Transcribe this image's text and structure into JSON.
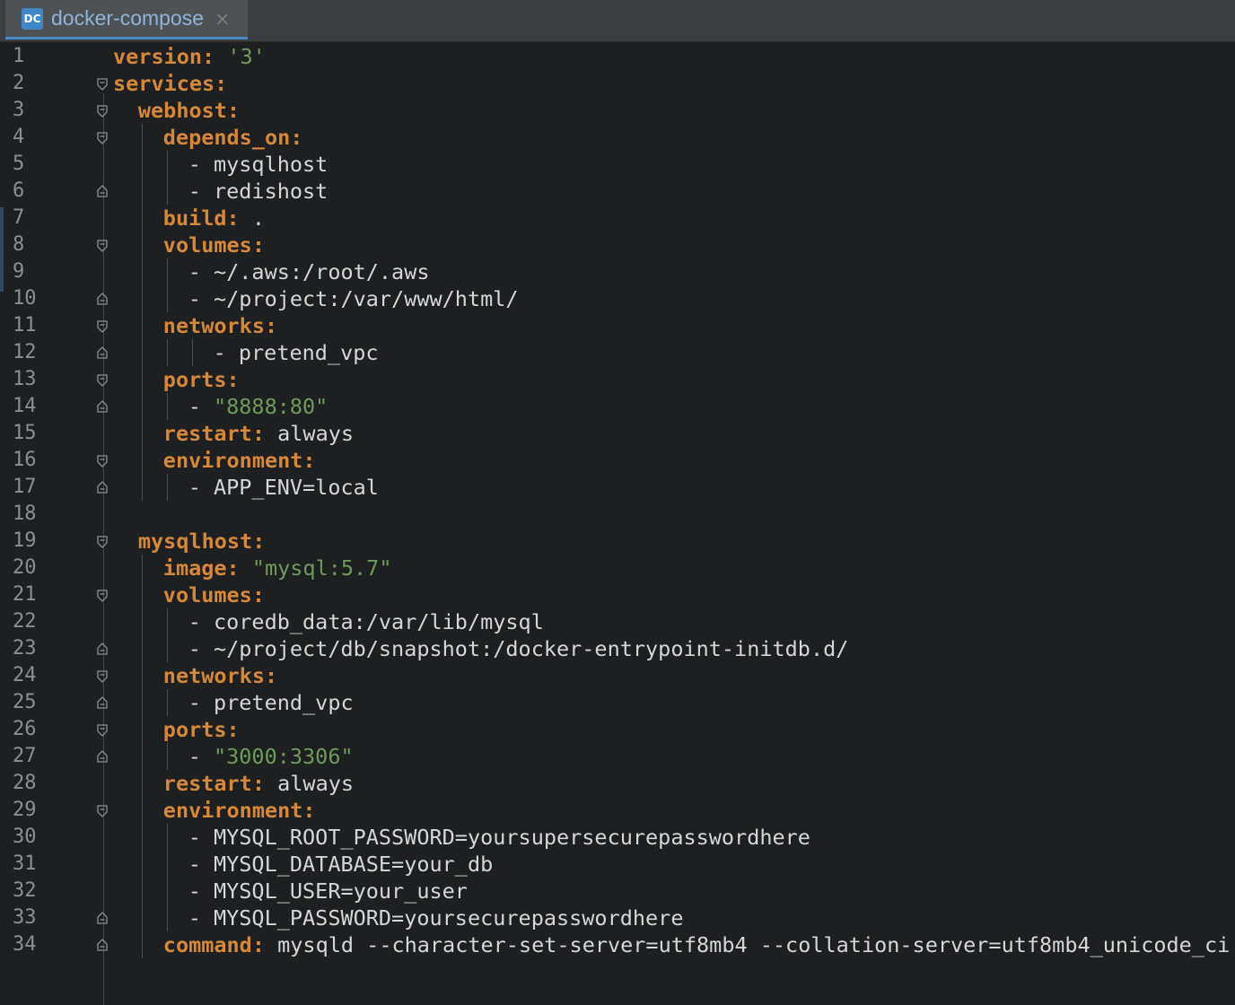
{
  "tab": {
    "icon_text": "DC",
    "title": "docker-compose",
    "close_glyph": "×"
  },
  "icons": {
    "file_icon": "docker-compose-file-icon",
    "close": "close-icon",
    "fold_open": "fold-open-icon",
    "fold_close": "fold-close-icon"
  },
  "colors": {
    "background": "#1e1f20",
    "key": "#d5873a",
    "string": "#6f9a5c",
    "text": "#d4d6d8",
    "line_number": "#8b8f93",
    "tab_accent": "#4a88c7"
  },
  "lines": [
    {
      "n": "1",
      "indent": 0,
      "fold": "",
      "parts": [
        {
          "t": "k",
          "text": "version:"
        },
        {
          "t": "v",
          "text": " "
        },
        {
          "t": "s",
          "text": "'3'"
        }
      ]
    },
    {
      "n": "2",
      "indent": 0,
      "fold": "open",
      "parts": [
        {
          "t": "k",
          "text": "services:"
        }
      ]
    },
    {
      "n": "3",
      "indent": 1,
      "fold": "open",
      "parts": [
        {
          "t": "k",
          "text": "webhost:"
        }
      ]
    },
    {
      "n": "4",
      "indent": 2,
      "fold": "open",
      "parts": [
        {
          "t": "k",
          "text": "depends_on:"
        }
      ]
    },
    {
      "n": "5",
      "indent": 3,
      "fold": "",
      "parts": [
        {
          "t": "v",
          "text": "- mysqlhost"
        }
      ]
    },
    {
      "n": "6",
      "indent": 3,
      "fold": "close",
      "parts": [
        {
          "t": "v",
          "text": "- redishost"
        }
      ]
    },
    {
      "n": "7",
      "indent": 2,
      "fold": "",
      "parts": [
        {
          "t": "k",
          "text": "build:"
        },
        {
          "t": "v",
          "text": " ."
        }
      ]
    },
    {
      "n": "8",
      "indent": 2,
      "fold": "open",
      "parts": [
        {
          "t": "k",
          "text": "volumes:"
        }
      ]
    },
    {
      "n": "9",
      "indent": 3,
      "fold": "",
      "parts": [
        {
          "t": "v",
          "text": "- ~/.aws:/root/.aws"
        }
      ]
    },
    {
      "n": "10",
      "indent": 3,
      "fold": "close",
      "parts": [
        {
          "t": "v",
          "text": "- ~/project:/var/www/html/"
        }
      ]
    },
    {
      "n": "11",
      "indent": 2,
      "fold": "open",
      "parts": [
        {
          "t": "k",
          "text": "networks:"
        }
      ]
    },
    {
      "n": "12",
      "indent": 4,
      "fold": "close",
      "parts": [
        {
          "t": "v",
          "text": "- pretend_vpc"
        }
      ]
    },
    {
      "n": "13",
      "indent": 2,
      "fold": "open",
      "parts": [
        {
          "t": "k",
          "text": "ports:"
        }
      ]
    },
    {
      "n": "14",
      "indent": 3,
      "fold": "close",
      "parts": [
        {
          "t": "v",
          "text": "- "
        },
        {
          "t": "s",
          "text": "\"8888:80\""
        }
      ]
    },
    {
      "n": "15",
      "indent": 2,
      "fold": "",
      "parts": [
        {
          "t": "k",
          "text": "restart:"
        },
        {
          "t": "v",
          "text": " always"
        }
      ]
    },
    {
      "n": "16",
      "indent": 2,
      "fold": "open",
      "parts": [
        {
          "t": "k",
          "text": "environment:"
        }
      ]
    },
    {
      "n": "17",
      "indent": 3,
      "fold": "close",
      "parts": [
        {
          "t": "v",
          "text": "- APP_ENV=local"
        }
      ]
    },
    {
      "n": "18",
      "indent": 0,
      "fold": "",
      "parts": []
    },
    {
      "n": "19",
      "indent": 1,
      "fold": "open",
      "parts": [
        {
          "t": "k",
          "text": "mysqlhost:"
        }
      ]
    },
    {
      "n": "20",
      "indent": 2,
      "fold": "",
      "parts": [
        {
          "t": "k",
          "text": "image:"
        },
        {
          "t": "v",
          "text": " "
        },
        {
          "t": "s",
          "text": "\"mysql:5.7\""
        }
      ]
    },
    {
      "n": "21",
      "indent": 2,
      "fold": "open",
      "parts": [
        {
          "t": "k",
          "text": "volumes:"
        }
      ]
    },
    {
      "n": "22",
      "indent": 3,
      "fold": "",
      "parts": [
        {
          "t": "v",
          "text": "- coredb_data:/var/lib/mysql"
        }
      ]
    },
    {
      "n": "23",
      "indent": 3,
      "fold": "close",
      "parts": [
        {
          "t": "v",
          "text": "- ~/project/db/snapshot:/docker-entrypoint-initdb.d/"
        }
      ]
    },
    {
      "n": "24",
      "indent": 2,
      "fold": "open",
      "parts": [
        {
          "t": "k",
          "text": "networks:"
        }
      ]
    },
    {
      "n": "25",
      "indent": 3,
      "fold": "close",
      "parts": [
        {
          "t": "v",
          "text": "- pretend_vpc"
        }
      ]
    },
    {
      "n": "26",
      "indent": 2,
      "fold": "open",
      "parts": [
        {
          "t": "k",
          "text": "ports:"
        }
      ]
    },
    {
      "n": "27",
      "indent": 3,
      "fold": "close",
      "parts": [
        {
          "t": "v",
          "text": "- "
        },
        {
          "t": "s",
          "text": "\"3000:3306\""
        }
      ]
    },
    {
      "n": "28",
      "indent": 2,
      "fold": "",
      "parts": [
        {
          "t": "k",
          "text": "restart:"
        },
        {
          "t": "v",
          "text": " always"
        }
      ]
    },
    {
      "n": "29",
      "indent": 2,
      "fold": "open",
      "parts": [
        {
          "t": "k",
          "text": "environment:"
        }
      ]
    },
    {
      "n": "30",
      "indent": 3,
      "fold": "",
      "parts": [
        {
          "t": "v",
          "text": "- MYSQL_ROOT_PASSWORD=yoursupersecurepasswordhere"
        }
      ]
    },
    {
      "n": "31",
      "indent": 3,
      "fold": "",
      "parts": [
        {
          "t": "v",
          "text": "- MYSQL_DATABASE=your_db"
        }
      ]
    },
    {
      "n": "32",
      "indent": 3,
      "fold": "",
      "parts": [
        {
          "t": "v",
          "text": "- MYSQL_USER=your_user"
        }
      ]
    },
    {
      "n": "33",
      "indent": 3,
      "fold": "close",
      "parts": [
        {
          "t": "v",
          "text": "- MYSQL_PASSWORD=yoursecurepasswordhere"
        }
      ]
    },
    {
      "n": "34",
      "indent": 2,
      "fold": "close",
      "parts": [
        {
          "t": "k",
          "text": "command:"
        },
        {
          "t": "v",
          "text": " mysqld --character-set-server=utf8mb4 --collation-server=utf8mb4_unicode_ci"
        }
      ]
    }
  ]
}
